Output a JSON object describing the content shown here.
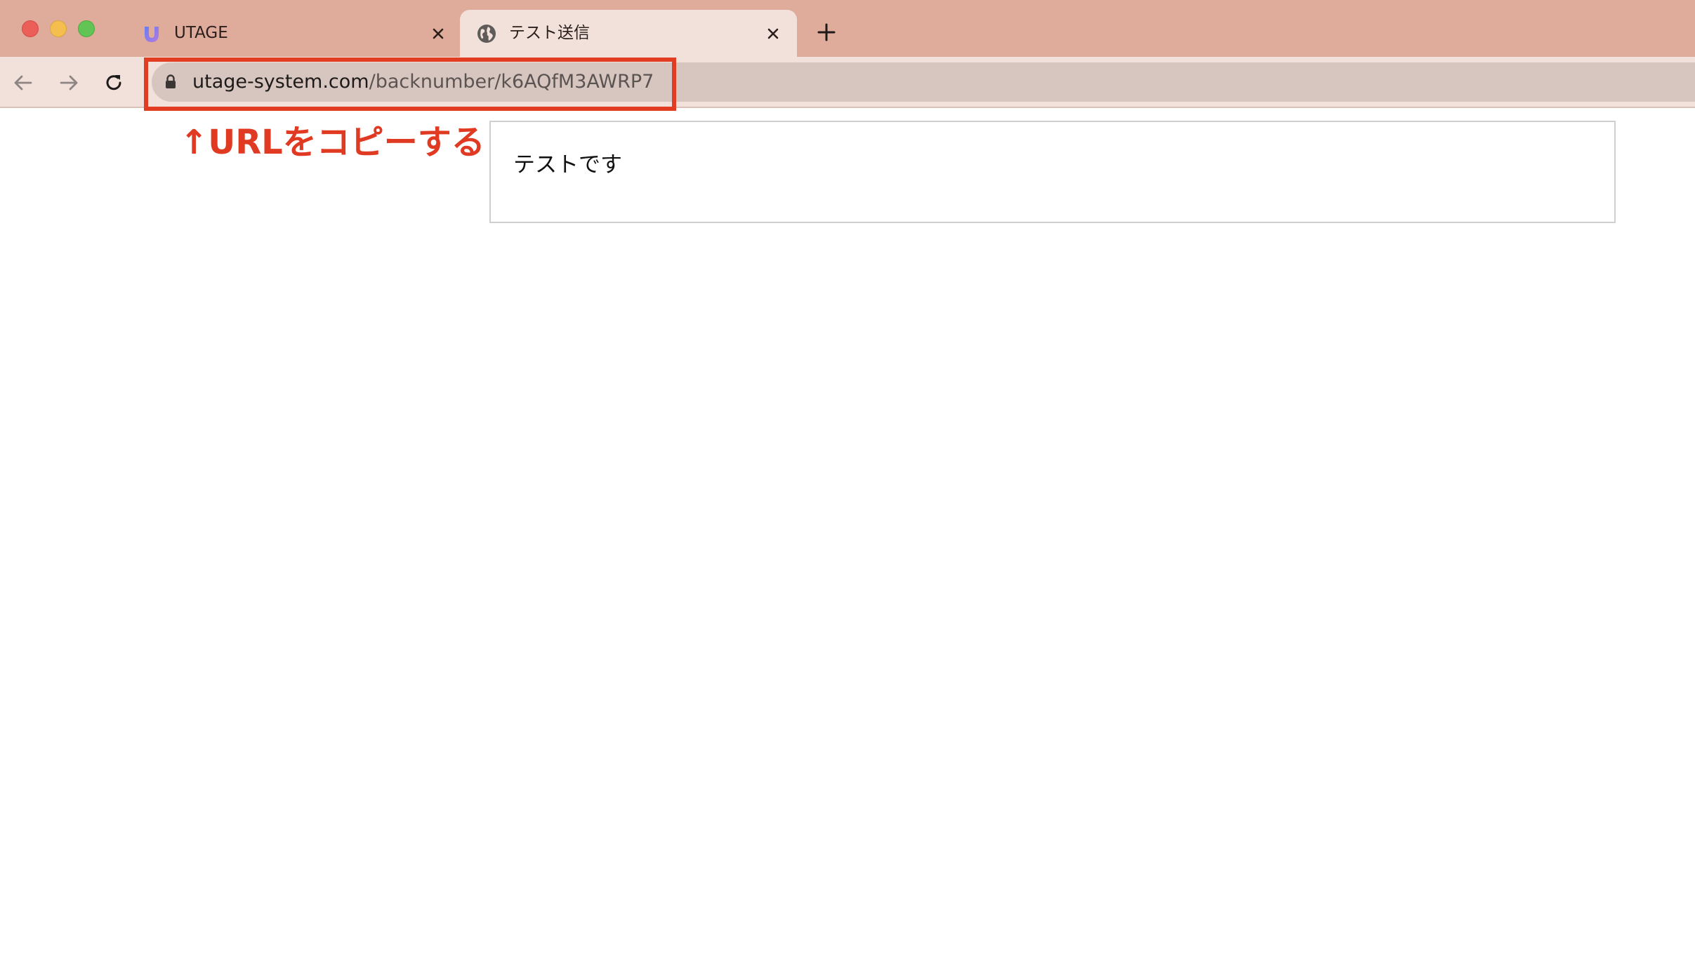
{
  "window": {
    "traffic_lights": [
      "close",
      "minimize",
      "zoom"
    ]
  },
  "tabs": [
    {
      "title": "UTAGE",
      "icon": "utage-logo-icon",
      "active": false
    },
    {
      "title": "テスト送信",
      "icon": "globe-icon",
      "active": true
    }
  ],
  "toolbar": {
    "url_host": "utage-system.com",
    "url_path": "/backnumber/k6AQfM3AWRP7"
  },
  "annotation": {
    "text": "↑URLをコピーする",
    "color": "#e03a22"
  },
  "page": {
    "message": "テストです"
  },
  "colors": {
    "tabstrip": "#dfab9b",
    "active_tab": "#f2e1da",
    "omnibox": "#d7c6c0",
    "highlight": "#e23d23"
  }
}
